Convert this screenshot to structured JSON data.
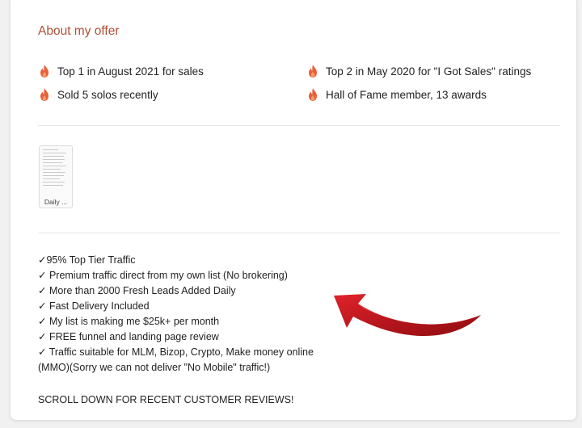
{
  "offer": {
    "title": "About my offer",
    "badges": [
      {
        "icon": "flame-icon",
        "text": "Top 1 in August 2021 for sales"
      },
      {
        "icon": "flame-icon",
        "text": "Top 2 in May 2020 for \"I Got Sales\" ratings"
      },
      {
        "icon": "flame-icon",
        "text": "Sold 5 solos recently"
      },
      {
        "icon": "flame-icon",
        "text": "Hall of Fame member, 13 awards"
      }
    ],
    "flame_color": "#e8613a"
  },
  "attachment": {
    "label": "Daily ..."
  },
  "features": [
    "✓95% Top Tier Traffic",
    "✓ Premium traffic direct from my own list (No brokering)",
    "✓ More than 2000 Fresh Leads Added Daily",
    "✓ Fast Delivery Included",
    "✓ My list is making me $25k+ per month",
    "✓ FREE funnel and landing page review",
    "✓ Traffic suitable for MLM, Bizop, Crypto, Make money online",
    "(MMO)(Sorry we can not deliver \"No Mobile\" traffic!)"
  ],
  "cta": "SCROLL DOWN FOR RECENT CUSTOMER REVIEWS!",
  "accent_color": "#b14f35",
  "arrow_color": "#c8121a"
}
